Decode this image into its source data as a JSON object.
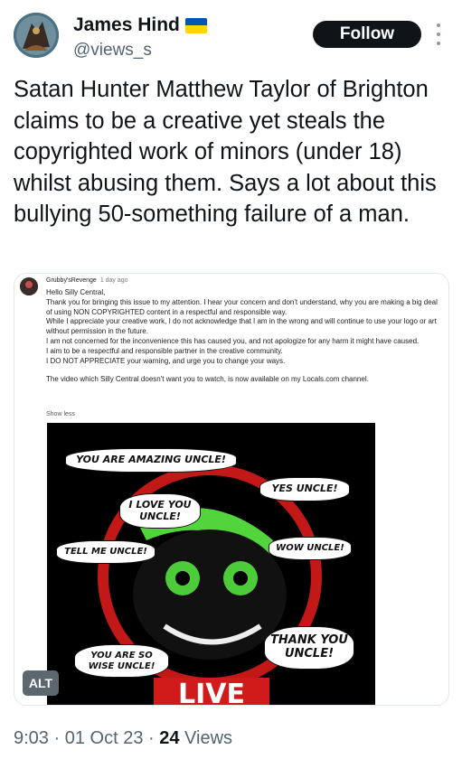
{
  "author": {
    "name": "James Hind",
    "handle": "@views_s",
    "follow_label": "Follow"
  },
  "tweet": {
    "text": "Satan Hunter Matthew Taylor of Brighton claims to be a creative yet steals the copyrighted work of minors (under 18) whilst abusing them.  Says a lot about this bullying 50-something failure of a man."
  },
  "media": {
    "alt_label": "ALT",
    "comment": {
      "author": "Grubby'sRevenge",
      "time": "1 day ago",
      "lines": [
        "Hello Silly Central,",
        "Thank you for bringing this issue to my attention. I hear your concern and don't understand, why you are making a big deal of using NON COPYRIGHTED content in a respectful and responsible way.",
        "While I appreciate your creative work, I do not acknowledge that I am in the wrong and will continue to use your logo or art without permission in the future.",
        "I am not concerned for the inconvenience this has caused you, and not apologize for any harm it might have caused.",
        "I aim to be a respectful and responsible partner in the creative community.",
        "I DO NOT APPRECIATE your warning, and urge you to change your ways.",
        "",
        "The video which Silly Central doesn't want you to watch, is now available on my Locals.com channel."
      ],
      "show_less": "Show less"
    },
    "thumbnail": {
      "bubbles": [
        "YOU ARE AMAZING UNCLE!",
        "YES UNCLE!",
        "I LOVE YOU UNCLE!",
        "TELL ME UNCLE!",
        "WOW UNCLE!",
        "THANK YOU UNCLE!",
        "YOU ARE SO WISE UNCLE!"
      ],
      "live_text": "LIVE"
    }
  },
  "footer": {
    "time": "9:03",
    "date": "01 Oct 23",
    "views_count": "24",
    "views_label": "Views"
  },
  "colors": {
    "text": "#0f1419",
    "secondary": "#536471",
    "follow_bg": "#0f1419",
    "live_red": "#d11a1a",
    "face_green": "#4ecb3a"
  }
}
